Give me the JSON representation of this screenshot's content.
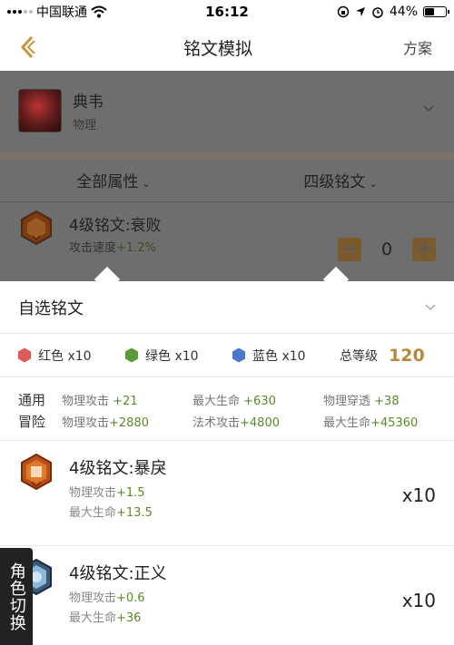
{
  "status_bar": {
    "carrier": "中国联通",
    "time": "16:12",
    "battery": "44%",
    "battery_level": 0.44
  },
  "nav": {
    "title": "铭文模拟",
    "action": "方案"
  },
  "hero": {
    "name": "典韦",
    "type": "物理"
  },
  "filters": {
    "attribute": "全部属性",
    "level": "四级铭文"
  },
  "selected_rune": {
    "name": "4级铭文:衰败",
    "attr_label": "攻击速度",
    "attr_value": "+1.2%",
    "count": "0"
  },
  "sheet": {
    "title": "自选铭文",
    "colors": [
      {
        "label": "红色 x10",
        "color": "#e05a5a"
      },
      {
        "label": "绿色 x10",
        "color": "#5a9a3a"
      },
      {
        "label": "蓝色 x10",
        "color": "#4a78c8"
      }
    ],
    "total_label": "总等级",
    "total_value": "120",
    "stats": [
      {
        "category": "通用",
        "cells": [
          {
            "label": "物理攻击",
            "value": "+21"
          },
          {
            "label": "最大生命",
            "value": "+630"
          },
          {
            "label": "物理穿透",
            "value": "+38"
          }
        ]
      },
      {
        "category": "冒险",
        "cells": [
          {
            "label": "物理攻击",
            "value": "+2880"
          },
          {
            "label": "法术攻击",
            "value": "+4800"
          },
          {
            "label": "最大生命",
            "value": "+45360"
          }
        ]
      }
    ],
    "runes": [
      {
        "name": "4级铭文:暴戾",
        "attrs": [
          {
            "label": "物理攻击",
            "value": "+1.5"
          },
          {
            "label": "最大生命",
            "value": "+13.5"
          }
        ],
        "qty": "x10"
      },
      {
        "name": "4级铭文:正义",
        "attrs": [
          {
            "label": "物理攻击",
            "value": "+0.6"
          },
          {
            "label": "最大生命",
            "value": "+36"
          }
        ],
        "qty": "x10"
      }
    ]
  },
  "role_switch": "角色切换"
}
